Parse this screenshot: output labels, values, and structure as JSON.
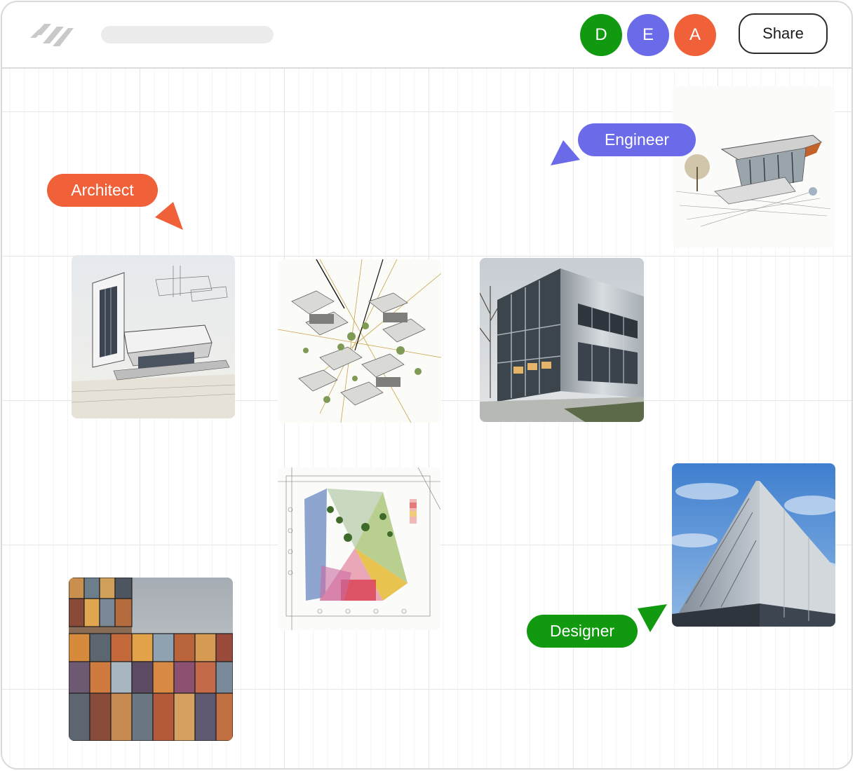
{
  "colors": {
    "architect": "#f0613a",
    "engineer": "#6b6bea",
    "designer": "#11990f",
    "grid_major": "#e6e6e6",
    "grid_minor": "#f4f4f4",
    "title_placeholder": "#ececec"
  },
  "header": {
    "logo_icon": "hash-stripes-logo-icon",
    "collaborators": [
      {
        "initial": "D",
        "color": "#11990f"
      },
      {
        "initial": "E",
        "color": "#6b6bea"
      },
      {
        "initial": "A",
        "color": "#f0613a"
      }
    ],
    "share_label": "Share"
  },
  "cursors": {
    "architect": {
      "label": "Architect",
      "icon": "cursor-arrow-icon"
    },
    "engineer": {
      "label": "Engineer",
      "icon": "cursor-arrow-icon"
    },
    "designer": {
      "label": "Designer",
      "icon": "cursor-arrow-icon"
    }
  },
  "cards": [
    {
      "id": "sketch-building-left",
      "subject": "architectural sketch of cantilevered building"
    },
    {
      "id": "isometric-city-plan",
      "subject": "isometric urban planning drawing"
    },
    {
      "id": "glass-office-photo",
      "subject": "photo of glass and metal office building"
    },
    {
      "id": "sketch-building-top-right",
      "subject": "sketch of angular building with orange roof"
    },
    {
      "id": "site-plan-color",
      "subject": "colored triangular site plan"
    },
    {
      "id": "facade-panels-photo",
      "subject": "colorful facade panel photo"
    },
    {
      "id": "blue-sky-facade-photo",
      "subject": "facade against blue sky"
    }
  ]
}
